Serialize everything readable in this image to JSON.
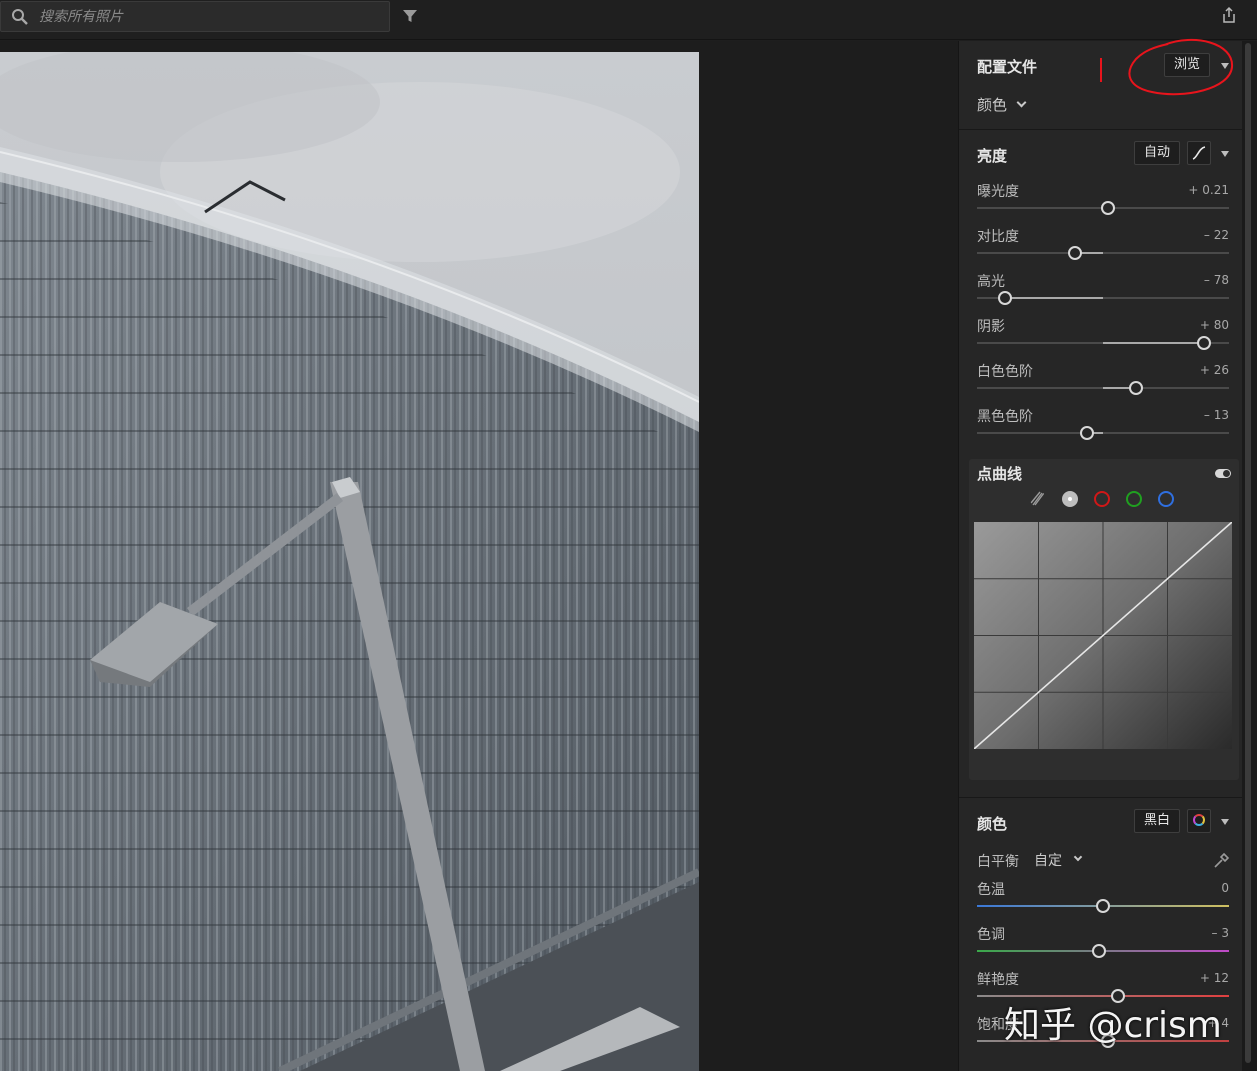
{
  "search": {
    "placeholder": "搜索所有照片"
  },
  "profile": {
    "title": "配置文件",
    "browse_label": "浏览",
    "profile_value": "颜色"
  },
  "light": {
    "title": "亮度",
    "auto_label": "自动",
    "sliders": [
      {
        "label": "曝光度",
        "value": "+ 0.21",
        "level": 0.521
      },
      {
        "label": "对比度",
        "value": "– 22",
        "level": 0.39
      },
      {
        "label": "高光",
        "value": "– 78",
        "level": 0.11
      },
      {
        "label": "阴影",
        "value": "+ 80",
        "level": 0.9
      },
      {
        "label": "白色色阶",
        "value": "+ 26",
        "level": 0.63
      },
      {
        "label": "黑色色阶",
        "value": "– 13",
        "level": 0.435
      }
    ]
  },
  "curve": {
    "title": "点曲线",
    "enabled": true
  },
  "color": {
    "title": "颜色",
    "bw_label": "黑白",
    "wb_label": "白平衡",
    "wb_value": "自定",
    "sliders": [
      {
        "label": "色温",
        "value": "0",
        "level": 0.5
      },
      {
        "label": "色调",
        "value": "– 3",
        "level": 0.485
      },
      {
        "label": "鲜艳度",
        "value": "+ 12",
        "level": 0.56
      },
      {
        "label": "饱和度",
        "value": "+ 4",
        "level": 0.52
      }
    ]
  },
  "watermark": "知乎 @crism",
  "colors": {
    "annotation": "#e8141c",
    "panel": "#262626",
    "accent_knob": "#d8d8d8"
  }
}
